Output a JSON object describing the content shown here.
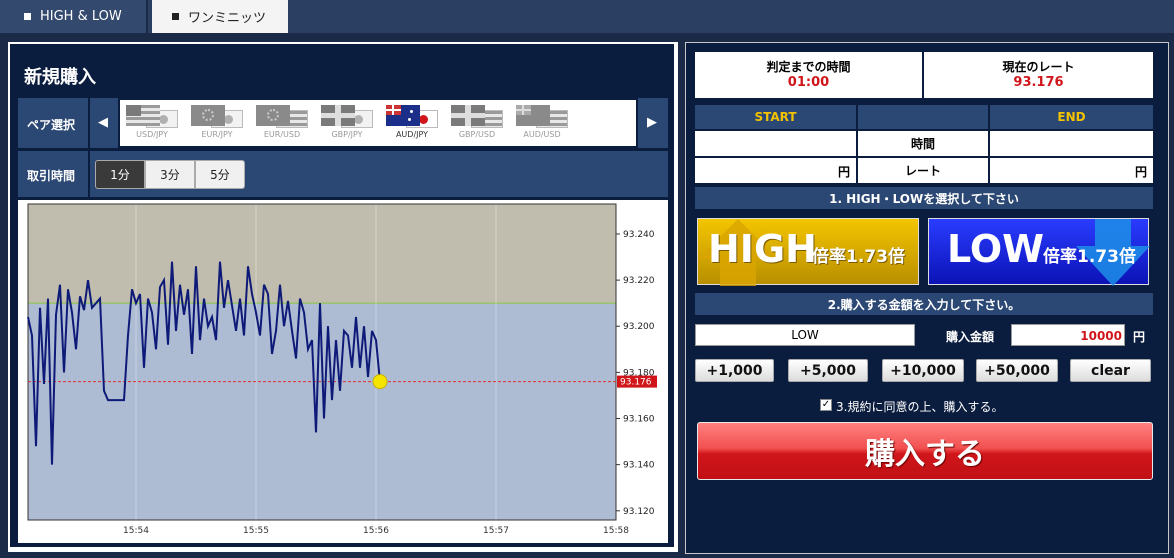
{
  "tabs": [
    {
      "label": "HIGH & LOW"
    },
    {
      "label": "ワンミニッツ"
    }
  ],
  "left": {
    "title": "新規購入",
    "pair_label": "ペア選択",
    "time_label": "取引時間",
    "pairs": [
      {
        "name": "USD/JPY"
      },
      {
        "name": "EUR/JPY"
      },
      {
        "name": "EUR/USD"
      },
      {
        "name": "GBP/JPY"
      },
      {
        "name": "AUD/JPY"
      },
      {
        "name": "GBP/USD"
      },
      {
        "name": "AUD/USD"
      }
    ],
    "selected_pair": "AUD/JPY",
    "times": [
      {
        "label": "1分"
      },
      {
        "label": "3分"
      },
      {
        "label": "5分"
      }
    ],
    "selected_time": "1分"
  },
  "chart_data": {
    "type": "line",
    "x_ticks": [
      "15:54",
      "15:55",
      "15:56",
      "15:57",
      "15:58"
    ],
    "y_ticks": [
      "93.240",
      "93.220",
      "93.200",
      "93.180",
      "93.160",
      "93.140",
      "93.120"
    ],
    "ylim": [
      93.116,
      93.253
    ],
    "xlim": [
      "15:53:06",
      "15:58:00"
    ],
    "current_rate": "93.176",
    "strike_level": 93.21,
    "series": [
      {
        "values": [
          [
            "15:53:06",
            93.204
          ],
          [
            "15:53:08",
            93.196
          ],
          [
            "15:53:10",
            93.148
          ],
          [
            "15:53:12",
            93.208
          ],
          [
            "15:53:14",
            93.175
          ],
          [
            "15:53:16",
            93.212
          ],
          [
            "15:53:18",
            93.14
          ],
          [
            "15:53:20",
            93.205
          ],
          [
            "15:53:22",
            93.218
          ],
          [
            "15:53:24",
            93.18
          ],
          [
            "15:53:26",
            93.216
          ],
          [
            "15:53:28",
            93.206
          ],
          [
            "15:53:30",
            93.19
          ],
          [
            "15:53:32",
            93.213
          ],
          [
            "15:53:34",
            93.207
          ],
          [
            "15:53:36",
            93.22
          ],
          [
            "15:53:38",
            93.208
          ],
          [
            "15:53:40",
            93.21
          ],
          [
            "15:53:42",
            93.212
          ],
          [
            "15:53:44",
            93.172
          ],
          [
            "15:53:46",
            93.168
          ],
          [
            "15:53:48",
            93.168
          ],
          [
            "15:53:50",
            93.168
          ],
          [
            "15:53:52",
            93.168
          ],
          [
            "15:53:54",
            93.168
          ],
          [
            "15:53:56",
            93.196
          ],
          [
            "15:53:58",
            93.216
          ],
          [
            "15:54:00",
            93.21
          ],
          [
            "15:54:02",
            93.214
          ],
          [
            "15:54:04",
            93.182
          ],
          [
            "15:54:06",
            93.212
          ],
          [
            "15:54:08",
            93.206
          ],
          [
            "15:54:10",
            93.19
          ],
          [
            "15:54:12",
            93.217
          ],
          [
            "15:54:14",
            93.22
          ],
          [
            "15:54:16",
            93.192
          ],
          [
            "15:54:18",
            93.228
          ],
          [
            "15:54:20",
            93.198
          ],
          [
            "15:54:22",
            93.218
          ],
          [
            "15:54:24",
            93.205
          ],
          [
            "15:54:26",
            93.216
          ],
          [
            "15:54:28",
            93.188
          ],
          [
            "15:54:30",
            93.226
          ],
          [
            "15:54:32",
            93.194
          ],
          [
            "15:54:34",
            93.212
          ],
          [
            "15:54:36",
            93.2
          ],
          [
            "15:54:38",
            93.204
          ],
          [
            "15:54:40",
            93.194
          ],
          [
            "15:54:42",
            93.228
          ],
          [
            "15:54:44",
            93.208
          ],
          [
            "15:54:46",
            93.22
          ],
          [
            "15:54:48",
            93.209
          ],
          [
            "15:54:50",
            93.198
          ],
          [
            "15:54:52",
            93.212
          ],
          [
            "15:54:54",
            93.196
          ],
          [
            "15:54:56",
            93.226
          ],
          [
            "15:54:58",
            93.214
          ],
          [
            "15:55:00",
            93.206
          ],
          [
            "15:55:02",
            93.196
          ],
          [
            "15:55:04",
            93.218
          ],
          [
            "15:55:06",
            93.214
          ],
          [
            "15:55:08",
            93.188
          ],
          [
            "15:55:10",
            93.198
          ],
          [
            "15:55:12",
            93.218
          ],
          [
            "15:55:14",
            93.2
          ],
          [
            "15:55:16",
            93.211
          ],
          [
            "15:55:18",
            93.198
          ],
          [
            "15:55:20",
            93.186
          ],
          [
            "15:55:22",
            93.212
          ],
          [
            "15:55:24",
            93.206
          ],
          [
            "15:55:26",
            93.19
          ],
          [
            "15:55:28",
            93.194
          ],
          [
            "15:55:30",
            93.154
          ],
          [
            "15:55:32",
            93.21
          ],
          [
            "15:55:34",
            93.16
          ],
          [
            "15:55:36",
            93.2
          ],
          [
            "15:55:38",
            93.168
          ],
          [
            "15:55:40",
            93.194
          ],
          [
            "15:55:42",
            93.172
          ],
          [
            "15:55:44",
            93.198
          ],
          [
            "15:55:46",
            93.196
          ],
          [
            "15:55:48",
            93.182
          ],
          [
            "15:55:50",
            93.204
          ],
          [
            "15:55:52",
            93.182
          ],
          [
            "15:55:54",
            93.2
          ],
          [
            "15:55:56",
            93.178
          ],
          [
            "15:55:58",
            93.198
          ],
          [
            "15:56:00",
            93.194
          ],
          [
            "15:56:02",
            93.176
          ]
        ]
      }
    ]
  },
  "right": {
    "time_label": "判定までの時間",
    "time_value": "01:00",
    "rate_label": "現在のレート",
    "rate_value": "93.176",
    "start_label": "START",
    "end_label": "END",
    "time_row_label": "時間",
    "rate_row_label": "レート",
    "yen": "円",
    "step1": "1. HIGH・LOWを選択して下さい",
    "high_word": "HIGH",
    "high_rate": "倍率1.73倍",
    "low_word": "LOW",
    "low_rate": "倍率1.73倍",
    "step2": "2.購入する金額を入力して下さい。",
    "selected_side": "LOW",
    "amount_label": "購入金額",
    "amount_value": "10000",
    "amount_unit": "円",
    "amount_buttons": [
      {
        "label": "+1,000"
      },
      {
        "label": "+5,000"
      },
      {
        "label": "+10,000"
      },
      {
        "label": "+50,000"
      },
      {
        "label": "clear"
      }
    ],
    "agree_text": "3.規約に同意の上、購入する。",
    "agree_checked": true,
    "buy_label": "購入する"
  },
  "colors": {
    "navy": "#0b1d3e",
    "header_blue": "#2b4773",
    "gold": "#f3c200",
    "red": "#d0161b",
    "high_yellow": "#e8b400",
    "low_blue": "#1626e8"
  }
}
